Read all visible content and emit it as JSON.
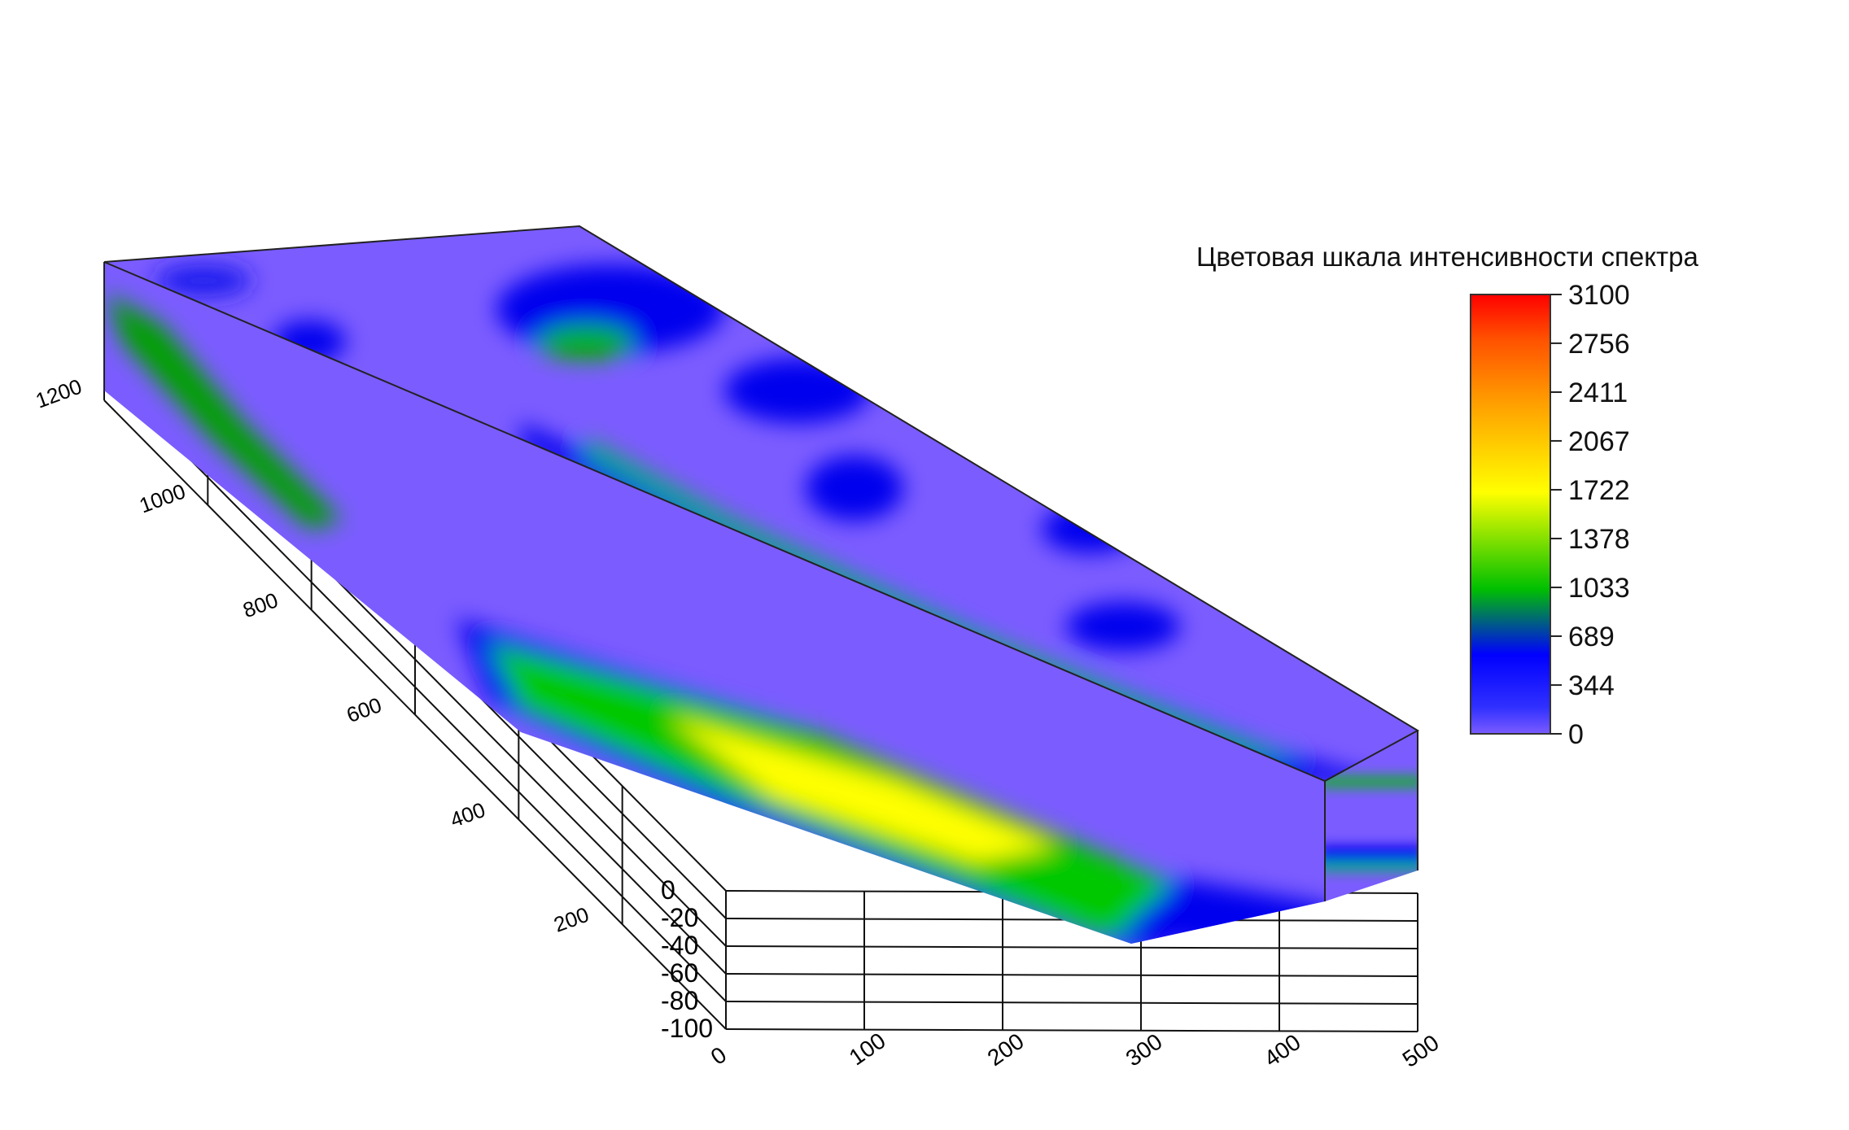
{
  "chart_data": {
    "type": "heatmap",
    "subtype": "3d-volume-slices",
    "title": "",
    "legend": {
      "title": "Цветовая шкала интенсивности спектра",
      "placement": "right",
      "ticks": [
        "3100",
        "2756",
        "2411",
        "2067",
        "1722",
        "1378",
        "1033",
        "689",
        "344",
        "0"
      ],
      "values": [
        3100,
        2756,
        2411,
        2067,
        1722,
        1378,
        1033,
        689,
        344,
        0
      ],
      "range": [
        0,
        3100
      ],
      "colors": [
        "#7b5cff",
        "#0000ff",
        "#00c000",
        "#ffff00",
        "#ff8000",
        "#ff0000"
      ]
    },
    "x_axis": {
      "label": "",
      "ticks": [
        "0",
        "100",
        "200",
        "300",
        "400",
        "500"
      ],
      "range": [
        0,
        500
      ]
    },
    "y_axis": {
      "label": "",
      "ticks": [
        "200",
        "400",
        "600",
        "800",
        "1000",
        "1200"
      ],
      "range": [
        0,
        1200
      ]
    },
    "z_axis": {
      "label": "",
      "ticks": [
        "0",
        "-20",
        "-40",
        "-60",
        "-80",
        "-100"
      ],
      "range": [
        -100,
        0
      ]
    },
    "grid": true
  }
}
